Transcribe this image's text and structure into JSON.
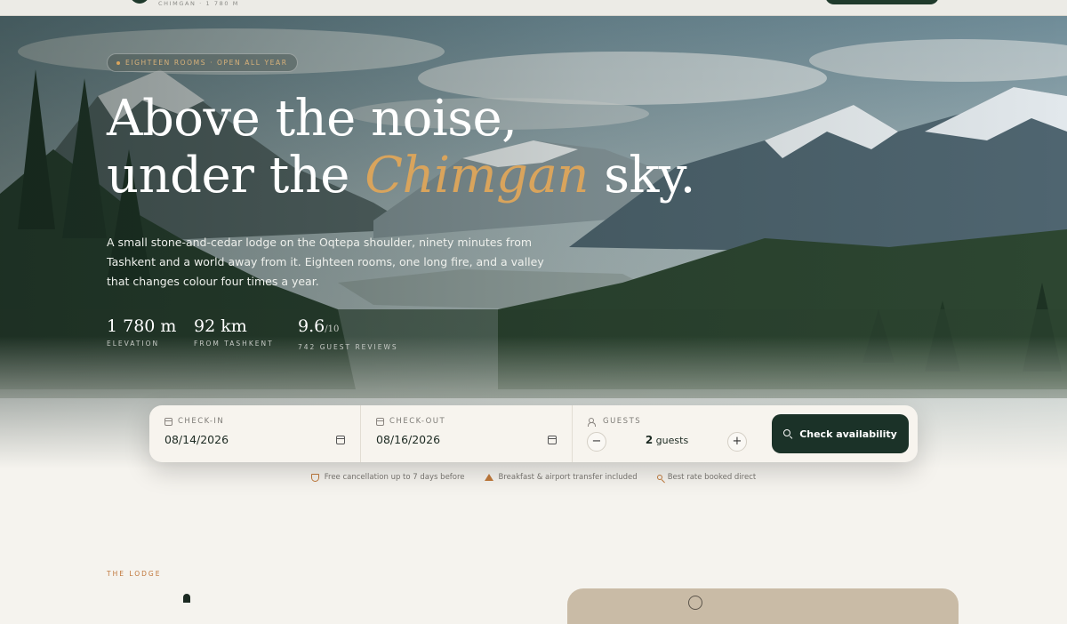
{
  "nav": {
    "brand_sub": "CHIMGAN · 1 780 M"
  },
  "hero": {
    "eyebrow": "EIGHTEEN ROOMS · OPEN ALL YEAR",
    "headline_line1": "Above the noise,",
    "headline_pre": "under the ",
    "headline_accent": "Chimgan",
    "headline_post": " sky.",
    "lede": "A small stone-and-cedar lodge on the Oqtepa shoulder, ninety minutes from Tashkent and a world away from it. Eighteen rooms, one long fire, and a valley that changes colour four times a year.",
    "stats": [
      {
        "value": "1 780 m",
        "label": "ELEVATION"
      },
      {
        "value": "92 km",
        "label": "FROM TASHKENT"
      },
      {
        "value": "9.6",
        "suffix": "/10",
        "label": "742 GUEST REVIEWS"
      }
    ]
  },
  "booking": {
    "checkin_label": "CHECK-IN",
    "checkin_value": "08/14/2026",
    "checkout_label": "CHECK-OUT",
    "checkout_value": "08/16/2026",
    "guests_label": "GUESTS",
    "guests_count": "2",
    "guests_unit": "guests",
    "minus": "−",
    "plus": "+",
    "cta_label": "Check availability"
  },
  "trust": [
    "Free cancellation up to 7 days before",
    "Breakfast & airport transfer included",
    "Best rate booked direct"
  ],
  "lodge_section": {
    "eyebrow": "THE LODGE"
  },
  "colors": {
    "forest": "#1b3228",
    "accent": "#d9a45c",
    "copper": "#c0763a",
    "paper": "#f5f3ee"
  }
}
